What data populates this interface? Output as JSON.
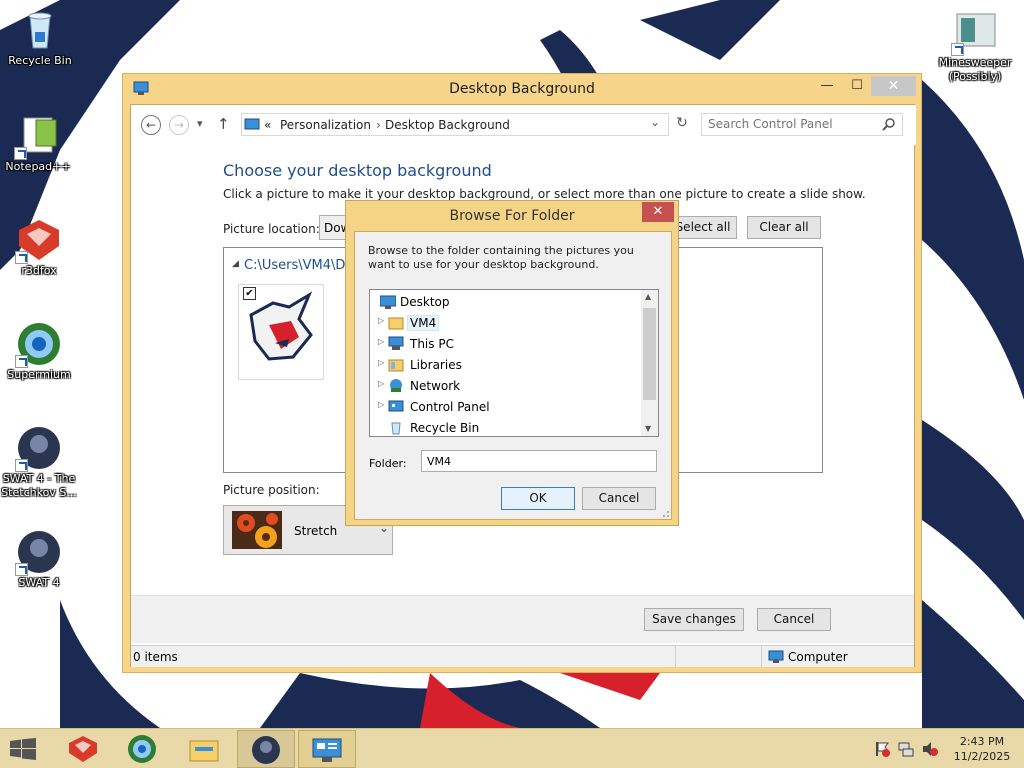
{
  "desktop": {
    "icons": [
      {
        "label": "Recycle Bin",
        "icon": "recycle-bin-icon"
      },
      {
        "label": "Notepad++",
        "icon": "notepad-plus-plus-icon"
      },
      {
        "label": "r3dfox",
        "icon": "r3dfox-icon"
      },
      {
        "label": "Supermium",
        "icon": "supermium-icon"
      },
      {
        "label": "SWAT 4 - The Stetchkov S...",
        "icon": "swat4-stetchkov-icon"
      },
      {
        "label": "SWAT 4",
        "icon": "swat4-icon"
      },
      {
        "label": "Minesweeper (Possibly)",
        "icon": "minesweeper-icon"
      }
    ]
  },
  "window": {
    "title": "Desktop Background",
    "caption": {
      "minimize": "—",
      "maximize": "☐",
      "close": "✕"
    },
    "nav": {
      "back": "←",
      "forward": "→",
      "dropdown": "▾",
      "up": "↑"
    },
    "breadcrumb": {
      "prefix": "«",
      "root": "Personalization",
      "separator": "›",
      "current": "Desktop Background"
    },
    "address_dropdown": "⌄",
    "refresh": "↻",
    "search": {
      "placeholder": "Search Control Panel",
      "icon": "search-icon"
    },
    "heading": "Choose your desktop background",
    "instruction": "Click a picture to make it your desktop background, or select more than one picture to create a slide show.",
    "picture_location_label": "Picture location:",
    "picture_location_value": "Dow",
    "select_all": "Select all",
    "clear_all": "Clear all",
    "folder_path": "C:\\Users\\VM4\\D",
    "folder_expander": "◢",
    "thumb_checked": "✔",
    "picture_position_label": "Picture position:",
    "picture_position_value": "Stretch",
    "picture_position_chevron": "⌄",
    "save_changes": "Save changes",
    "cancel": "Cancel",
    "status_items": "0 items",
    "status_location": "Computer"
  },
  "dialog": {
    "title": "Browse For Folder",
    "close": "✕",
    "description": "Browse to the folder containing the pictures you want to use for your desktop background.",
    "tree": [
      {
        "label": "Desktop",
        "expandable": false,
        "icon": "desktop-icon"
      },
      {
        "label": "VM4",
        "expandable": true,
        "icon": "user-folder-icon",
        "selected": true
      },
      {
        "label": "This PC",
        "expandable": true,
        "icon": "computer-icon"
      },
      {
        "label": "Libraries",
        "expandable": true,
        "icon": "libraries-icon"
      },
      {
        "label": "Network",
        "expandable": true,
        "icon": "network-icon"
      },
      {
        "label": "Control Panel",
        "expandable": true,
        "icon": "control-panel-icon"
      },
      {
        "label": "Recycle Bin",
        "expandable": false,
        "icon": "recycle-bin-icon"
      }
    ],
    "expand_glyph": "▷",
    "scroll_up": "▲",
    "scroll_down": "▼",
    "folder_label": "Folder:",
    "folder_value": "VM4",
    "ok": "OK",
    "cancel": "Cancel"
  },
  "taskbar": {
    "start_icon": "windows-start-icon",
    "items": [
      "r3dfox-icon",
      "supermium-icon",
      "file-explorer-icon",
      "swat4-icon",
      "control-panel-icon"
    ],
    "tray": [
      "action-center-flag-icon",
      "network-icon",
      "volume-muted-icon"
    ],
    "time": "2:43 PM",
    "date": "11/2/2025"
  },
  "colors": {
    "window_frame": "#f6d48a",
    "heading_blue": "#1e4f8c",
    "taskbar": "#e9d9a9",
    "close_red": "#c75050"
  }
}
